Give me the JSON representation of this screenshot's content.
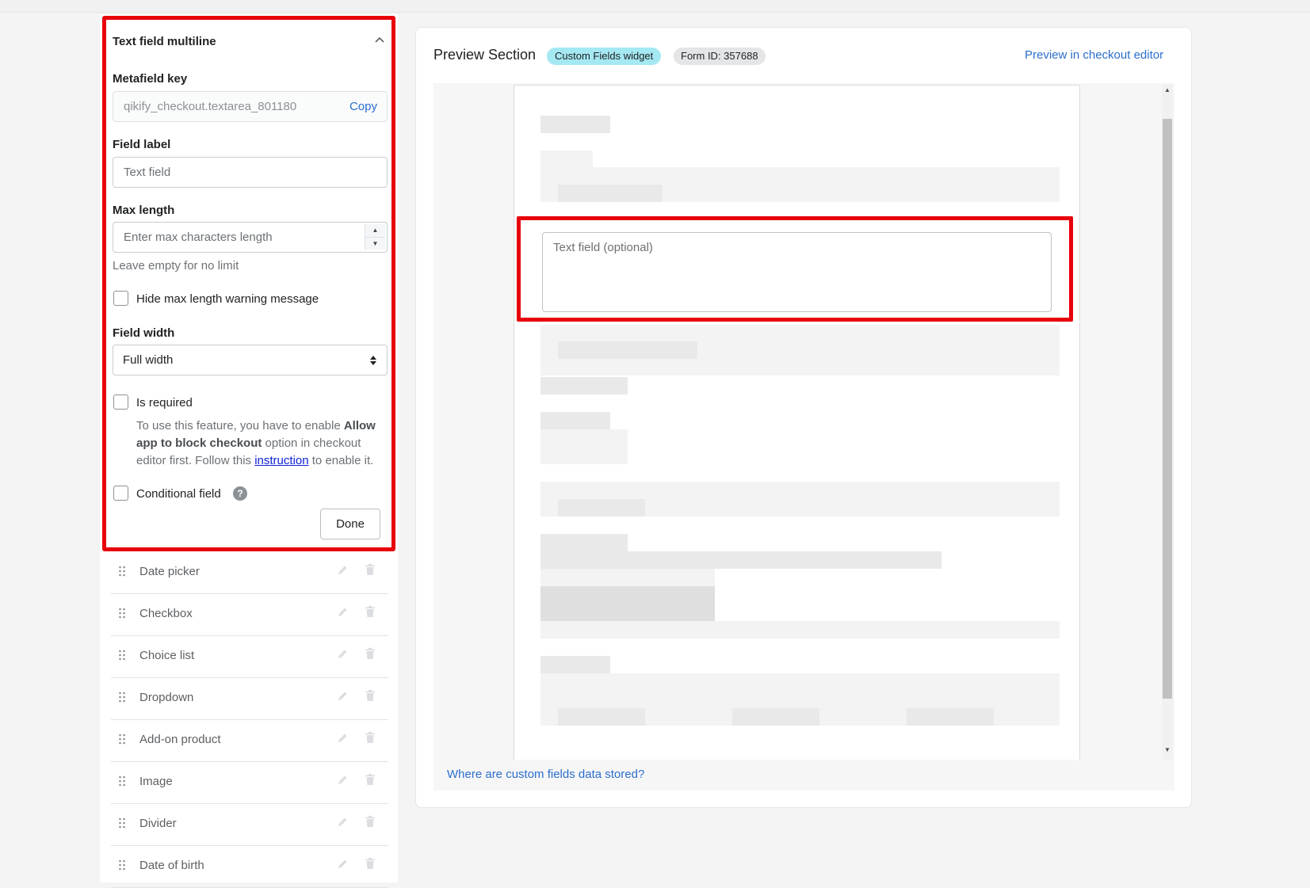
{
  "editor": {
    "title": "Text field multiline",
    "metafield_key_label": "Metafield key",
    "metafield_key_value": "qikify_checkout.textarea_801180",
    "copy_label": "Copy",
    "field_label_label": "Field label",
    "field_label_placeholder": "Text field",
    "max_length_label": "Max length",
    "max_length_placeholder": "Enter max characters length",
    "max_length_help": "Leave empty for no limit",
    "hide_warning_label": "Hide max length warning message",
    "field_width_label": "Field width",
    "field_width_value": "Full width",
    "is_required_label": "Is required",
    "note_prefix": "To use this feature, you have to enable ",
    "note_bold": "Allow app to block checkout",
    "note_middle": " option in checkout editor first. Follow this ",
    "note_link": "instruction",
    "note_suffix": " to enable it.",
    "conditional_label": "Conditional field",
    "help_glyph": "?",
    "done_label": "Done"
  },
  "field_list": [
    {
      "name": "Date picker"
    },
    {
      "name": "Checkbox"
    },
    {
      "name": "Choice list"
    },
    {
      "name": "Dropdown"
    },
    {
      "name": "Add-on product"
    },
    {
      "name": "Image"
    },
    {
      "name": "Divider"
    },
    {
      "name": "Date of birth"
    }
  ],
  "preview": {
    "title": "Preview Section",
    "widget_badge": "Custom Fields widget",
    "form_id_badge": "Form ID: 357688",
    "open_link": "Preview in checkout editor",
    "textarea_placeholder": "Text field (optional)",
    "footer_link": "Where are custom fields data stored?"
  },
  "colors": {
    "highlight": "#e8000b",
    "link": "#2c6ecb",
    "widget_badge_bg": "#a4e8f2"
  }
}
